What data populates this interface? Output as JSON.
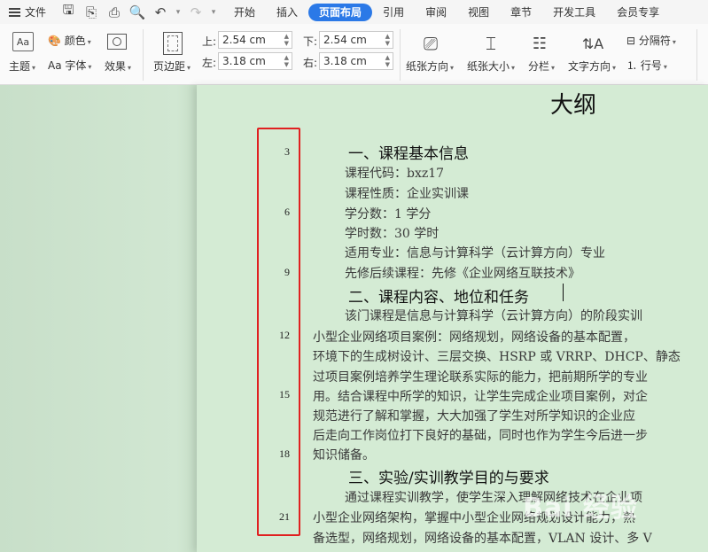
{
  "menubar": {
    "file_label": "文件",
    "tabs": [
      {
        "label": "开始",
        "active": false
      },
      {
        "label": "插入",
        "active": false
      },
      {
        "label": "页面布局",
        "active": true
      },
      {
        "label": "引用",
        "active": false
      },
      {
        "label": "审阅",
        "active": false
      },
      {
        "label": "视图",
        "active": false
      },
      {
        "label": "章节",
        "active": false
      },
      {
        "label": "开发工具",
        "active": false
      },
      {
        "label": "会员专享",
        "active": false
      }
    ]
  },
  "ribbon": {
    "theme_label": "主题",
    "color_label": "颜色",
    "font_label": "字体",
    "effect_label": "效果",
    "margin_label": "页边距",
    "top_label": "上:",
    "top_value": "2.54 cm",
    "bottom_label": "下:",
    "bottom_value": "2.54 cm",
    "left_label": "左:",
    "left_value": "3.18 cm",
    "right_label": "右:",
    "right_value": "3.18 cm",
    "orientation_label": "纸张方向",
    "size_label": "纸张大小",
    "columns_label": "分栏",
    "text_dir_label": "文字方向",
    "breaks_label": "分隔符",
    "line_num_label": "行号"
  },
  "document": {
    "title": "大纲",
    "line_numbers": [
      "3",
      "6",
      "9",
      "12",
      "15",
      "18",
      "21"
    ],
    "heading1": "一、课程基本信息",
    "info": [
      "课程代码：bxz17",
      "课程性质：企业实训课",
      "学分数：1 学分",
      "学时数：30 学时",
      "适用专业：信息与计算科学（云计算方向）专业",
      "先修后续课程：先修《企业网络互联技术》"
    ],
    "heading2": "二、课程内容、地位和任务",
    "para2": [
      "该门课程是信息与计算科学（云计算方向）的阶段实训",
      "小型企业网络项目案例：网络规划，网络设备的基本配置，",
      "环境下的生成树设计、三层交换、HSRP 或 VRRP、DHCP、静态",
      "过项目案例培养学生理论联系实际的能力，把前期所学的专业",
      "用。结合课程中所学的知识，让学生完成企业项目案例，对企",
      "规范进行了解和掌握，大大加强了学生对所学知识的企业应",
      "后走向工作岗位打下良好的基础，同时也作为学生今后进一步",
      "知识储备。"
    ],
    "heading3": "三、实验/实训教学目的与要求",
    "para3": [
      "通过课程实训教学，使学生深入理解网络技术在企业项",
      "小型企业网络架构，掌握中小型企业网络规划设计能力，熟",
      "备选型，网络规划，网络设备的基本配置，VLAN 设计、多 V"
    ],
    "watermark": "Bai 经验"
  }
}
